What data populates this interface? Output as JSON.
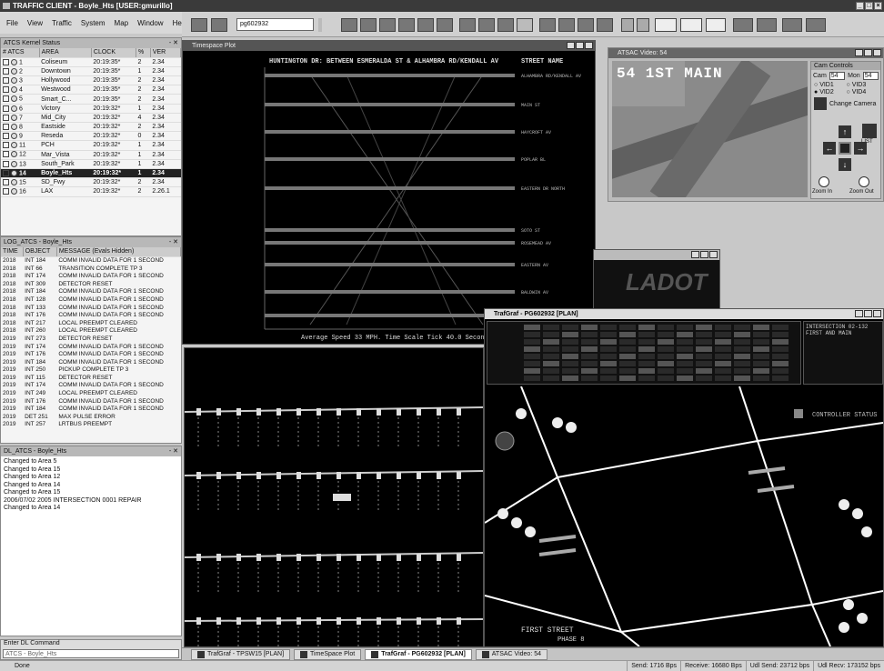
{
  "app": {
    "title": "TRAFFIC CLIENT - Boyle_Hts [USER:gmurillo]"
  },
  "menu": [
    "File",
    "View",
    "Traffic",
    "System",
    "Map",
    "Window",
    "Help"
  ],
  "toolbar": {
    "pg_value": "pg602932"
  },
  "atcs_panel": {
    "title": "ATCS Kernel Status",
    "headers": [
      "# ATCS",
      "AREA",
      "CLOCK",
      "%",
      "VER"
    ],
    "rows": [
      {
        "n": "1",
        "area": "Coliseum",
        "clock": "20:19:35*",
        "pct": "2",
        "ver": "2.34"
      },
      {
        "n": "2",
        "area": "Downtown",
        "clock": "20:19:35*",
        "pct": "1",
        "ver": "2.34"
      },
      {
        "n": "3",
        "area": "Hollywood",
        "clock": "20:19:35*",
        "pct": "2",
        "ver": "2.34"
      },
      {
        "n": "4",
        "area": "Westwood",
        "clock": "20:19:35*",
        "pct": "2",
        "ver": "2.34"
      },
      {
        "n": "5",
        "area": "Smart_C...",
        "clock": "20:19:35*",
        "pct": "2",
        "ver": "2.34"
      },
      {
        "n": "6",
        "area": "Victory",
        "clock": "20:19:32*",
        "pct": "1",
        "ver": "2.34"
      },
      {
        "n": "7",
        "area": "Mid_City",
        "clock": "20:19:32*",
        "pct": "4",
        "ver": "2.34"
      },
      {
        "n": "8",
        "area": "Eastside",
        "clock": "20:19:32*",
        "pct": "2",
        "ver": "2.34"
      },
      {
        "n": "9",
        "area": "Reseda",
        "clock": "20:19:32*",
        "pct": "0",
        "ver": "2.34"
      },
      {
        "n": "11",
        "area": "PCH",
        "clock": "20:19:32*",
        "pct": "1",
        "ver": "2.34"
      },
      {
        "n": "12",
        "area": "Mar_Vista",
        "clock": "20:19:32*",
        "pct": "1",
        "ver": "2.34"
      },
      {
        "n": "13",
        "area": "South_Park",
        "clock": "20:19:32*",
        "pct": "1",
        "ver": "2.34"
      },
      {
        "n": "14",
        "area": "Boyle_Hts",
        "clock": "20:19:32*",
        "pct": "1",
        "ver": "2.34"
      },
      {
        "n": "15",
        "area": "SD_Fwy",
        "clock": "20:19:32*",
        "pct": "2",
        "ver": "2.34"
      },
      {
        "n": "16",
        "area": "LAX",
        "clock": "20:19:32*",
        "pct": "2",
        "ver": "2.26.1"
      }
    ]
  },
  "log_panel": {
    "title": "LOG_ATCS - Boyle_Hts",
    "headers": [
      "TIME",
      "OBJECT",
      "MESSAGE (Evals Hidden)"
    ],
    "rows": [
      [
        "2018",
        "INT 184",
        "COMM INVALID DATA FOR 1 SECOND"
      ],
      [
        "2018",
        "INT 66",
        "TRANSITION COMPLETE     TP 3"
      ],
      [
        "2018",
        "INT 174",
        "COMM INVALID DATA FOR 1 SECOND"
      ],
      [
        "2018",
        "INT 309",
        "DETECTOR RESET"
      ],
      [
        "2018",
        "INT 184",
        "COMM INVALID DATA FOR 1 SECOND"
      ],
      [
        "2018",
        "INT 128",
        "COMM INVALID DATA FOR 1 SECOND"
      ],
      [
        "2018",
        "INT 133",
        "COMM INVALID DATA FOR 1 SECOND"
      ],
      [
        "2018",
        "INT 176",
        "COMM INVALID DATA FOR 1 SECOND"
      ],
      [
        "2018",
        "INT 217",
        "LOCAL PREEMPT CLEARED"
      ],
      [
        "2018",
        "INT 260",
        "LOCAL PREEMPT CLEARED"
      ],
      [
        "2019",
        "INT 273",
        "DETECTOR RESET"
      ],
      [
        "2019",
        "INT 174",
        "COMM INVALID DATA FOR 1 SECOND"
      ],
      [
        "2019",
        "INT 176",
        "COMM INVALID DATA FOR 1 SECOND"
      ],
      [
        "2019",
        "INT 184",
        "COMM INVALID DATA FOR 1 SECOND"
      ],
      [
        "2019",
        "INT 250",
        "PICKUP COMPLETE          TP 3"
      ],
      [
        "2019",
        "INT 115",
        "DETECTOR RESET"
      ],
      [
        "2019",
        "INT 174",
        "COMM INVALID DATA FOR 1 SECOND"
      ],
      [
        "2019",
        "INT 249",
        "LOCAL PREEMPT CLEARED"
      ],
      [
        "2019",
        "INT 176",
        "COMM INVALID DATA FOR 1 SECOND"
      ],
      [
        "2019",
        "INT 184",
        "COMM INVALID DATA FOR 1 SECOND"
      ],
      [
        "2019",
        "DET 251",
        "MAX PULSE ERROR"
      ],
      [
        "2019",
        "INT 257",
        "LRTBUS PREEMPT"
      ]
    ]
  },
  "dl_panel": {
    "title": "DL_ATCS - Boyle_Hts",
    "lines": [
      "Changed to Area 5",
      "Changed to Area 15",
      "Changed to Area 12",
      "Changed to Area 14",
      "Changed to Area 15",
      "2006/07/02 2005 INTERSECTION 0001 REPAIR",
      "Changed to Area 14"
    ]
  },
  "command": {
    "label": "Enter DL Command",
    "value": "ATCS - Boyle_Hts"
  },
  "timespace": {
    "title": "Timespace Plot",
    "header": "HUNTINGTON DR: BETWEEN ESMERALDA ST & ALHAMBRA RD/KENDALL AV",
    "street_header": "STREET NAME",
    "streets": [
      "ALHAMBRA RD/KENDALL AV",
      "MAIN ST",
      "HAYCROFT AV",
      "POPLAR BL",
      "EASTERN DR NORTH",
      "SOTO ST",
      "ROSEMEAD AV",
      "EASTERN AV",
      "BALDWIN AV",
      "COLE AV"
    ],
    "footer": "Average Speed 33 MPH.  Time Scale Tick 40.0 Seconds"
  },
  "video": {
    "title": "ATSAC Video: 54",
    "overlay": "54 1ST  MAIN",
    "controls_title": "Cam Controls",
    "cam_label": "Cam",
    "cam_value": "54",
    "mon_label": "Mon",
    "mon_value": "54",
    "vid_options": [
      "VID1",
      "VID2",
      "VID3",
      "VID4"
    ],
    "change_camera": "Change Camera",
    "zoom_in": "Zoom In",
    "zoom_out": "Zoom Out",
    "list": "LIST"
  },
  "ladot": {
    "text": "LADOT"
  },
  "trafgraf_plan": {
    "title": "TrafGraf - PG602932 [PLAN]",
    "intersection": "INTERSECTION 02-132",
    "street_lbl": "FIRST AND MAIN",
    "controller_status": "CONTROLLER STATUS",
    "street_label": "FIRST STREET",
    "phase_label": "PHASE 8"
  },
  "tabs": [
    {
      "label": "TrafGraf - TPSW15 [PLAN]",
      "active": false
    },
    {
      "label": "TimeSpace Plot",
      "active": false
    },
    {
      "label": "TrafGraf - PG602932 [PLAN]",
      "active": true
    },
    {
      "label": "ATSAC Video: 54",
      "active": false
    }
  ],
  "status": {
    "left": "Done",
    "send": "Send: 1716 Bps",
    "receive": "Receive: 16680 Bps",
    "udl_send": "Udl Send: 23712 bps",
    "udl_recv": "Udl Recv: 173152 bps"
  }
}
